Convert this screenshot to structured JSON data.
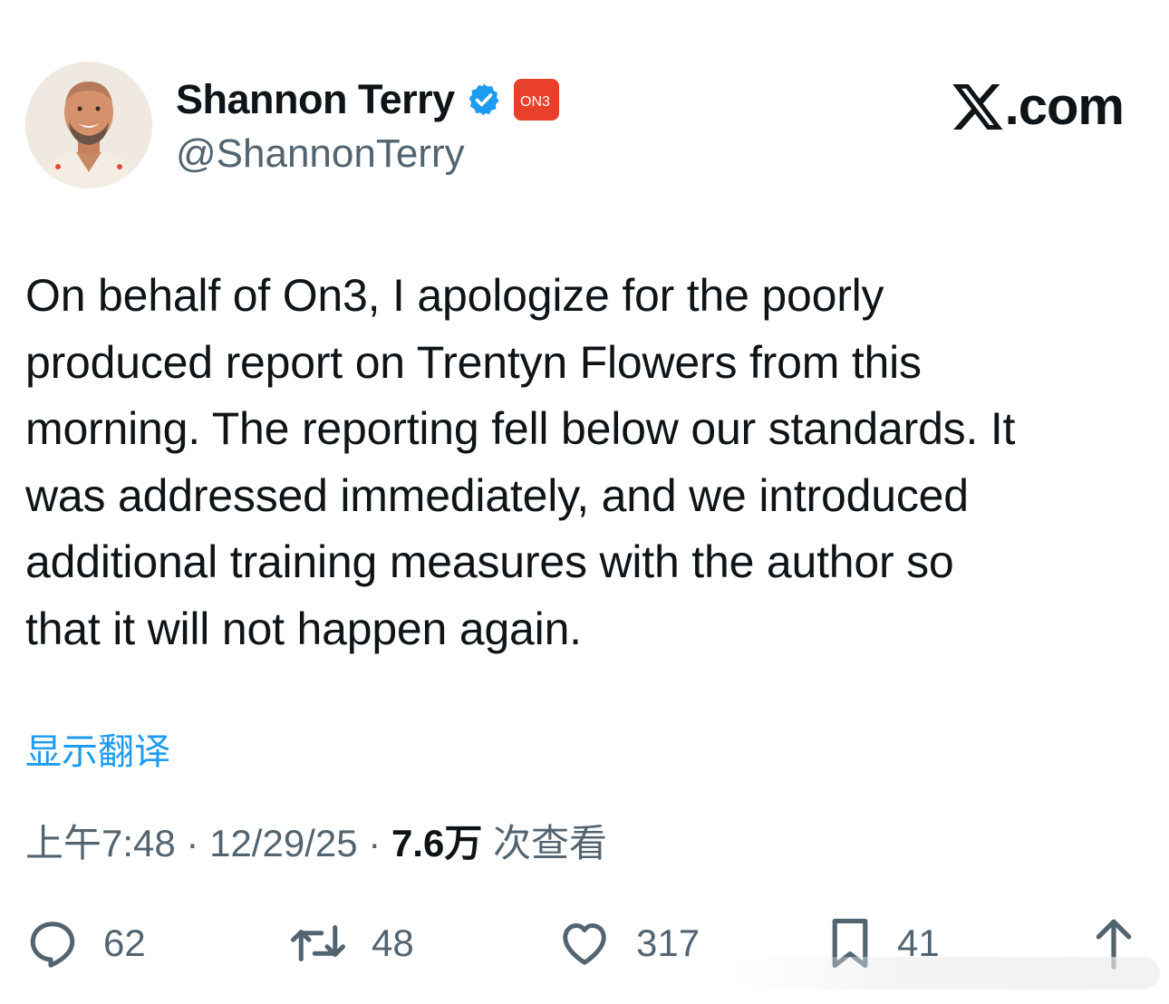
{
  "author": {
    "display_name": "Shannon Terry",
    "handle": "@ShannonTerry",
    "verified_icon": "verified-badge-icon",
    "affiliate_badge_text": "ON3",
    "avatar": "profile-photo"
  },
  "site": {
    "logo_icon": "x-logo-icon",
    "label": ".com"
  },
  "tweet": {
    "text": "On behalf of On3, I apologize for the poorly\nproduced report on Trentyn Flowers from this\nmorning. The reporting fell below our standards. It\nwas addressed immediately, and we introduced\nadditional training measures with the author so\nthat it will not happen again.",
    "translate_label": "显示翻译",
    "time": "上午7:48",
    "separator": "·",
    "date": "12/29/25",
    "views_count": "7.6万",
    "views_label": "次查看"
  },
  "actions": {
    "reply": {
      "icon": "reply-icon",
      "count": "62"
    },
    "retweet": {
      "icon": "retweet-icon",
      "count": "48"
    },
    "like": {
      "icon": "heart-icon",
      "count": "317"
    },
    "bookmark": {
      "icon": "bookmark-icon",
      "count": "41"
    },
    "share": {
      "icon": "share-icon"
    }
  },
  "colors": {
    "accent": "#1d9bf0",
    "text": "#0f1419",
    "secondary": "#536471",
    "badge_red": "#e8402a"
  }
}
